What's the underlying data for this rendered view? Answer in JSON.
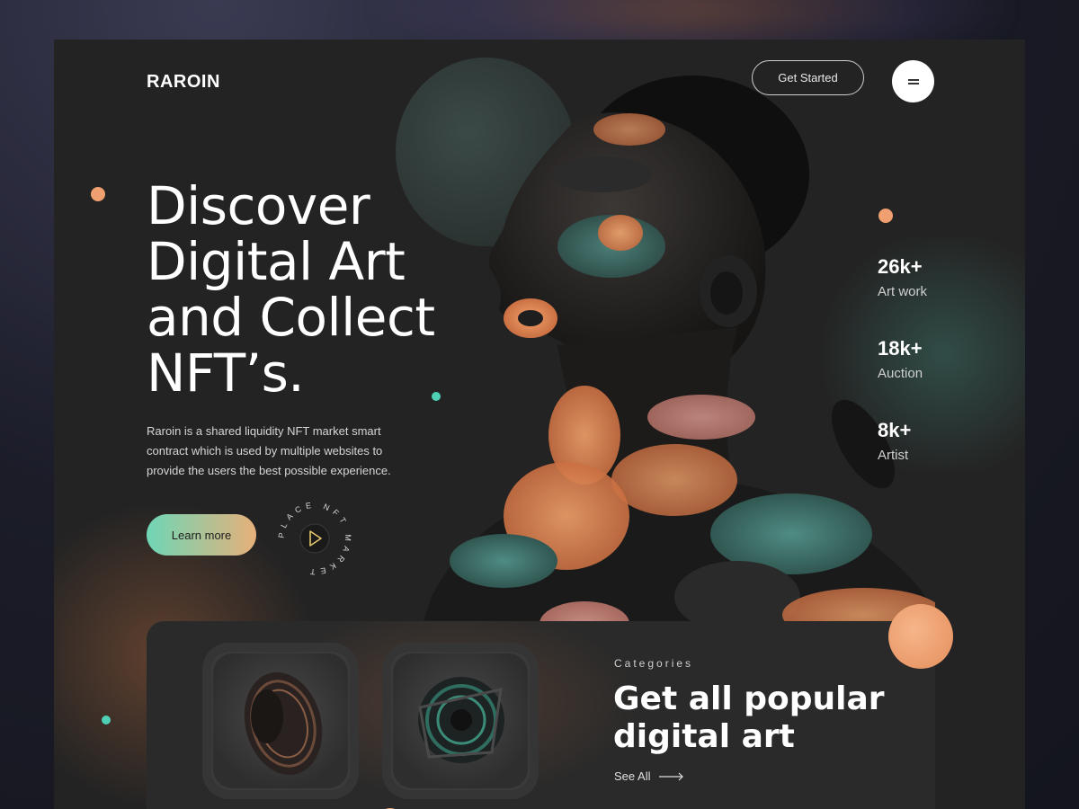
{
  "header": {
    "logo": "RAROIN",
    "get_started_label": "Get Started",
    "menu_icon": "menu-icon"
  },
  "hero": {
    "title_lines": [
      "Discover",
      "Digital Art",
      "and Collect",
      "NFT’s."
    ],
    "description": "Raroin is a shared liquidity NFT market smart contract which is used by multiple websites to provide the users the best possible experience.",
    "learn_more_label": "Learn more",
    "badge_text": "PLACE NFT MARKET",
    "badge_icon": "play-icon"
  },
  "stats": [
    {
      "value": "26k+",
      "label": "Art work"
    },
    {
      "value": "18k+",
      "label": "Auction"
    },
    {
      "value": "8k+",
      "label": "Artist"
    }
  ],
  "categories": {
    "eyebrow": "Categories",
    "title_lines": [
      "Get all popular",
      "digital art"
    ],
    "see_all_label": "See All"
  },
  "colors": {
    "accent_teal": "#6fd6b6",
    "accent_orange": "#e6b07a",
    "background": "#232323"
  }
}
